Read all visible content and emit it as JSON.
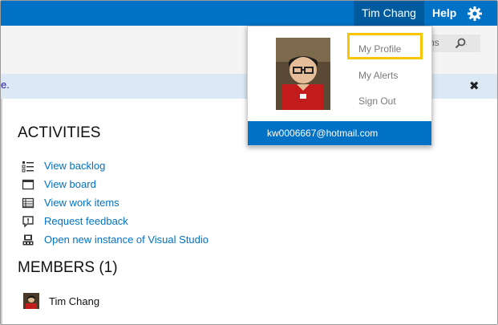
{
  "header": {
    "user_name": "Tim Chang",
    "help_label": "Help"
  },
  "toolbar": {
    "search_partial": "ns"
  },
  "banner": {
    "text_fragment": "e.",
    "close_symbol": "✖"
  },
  "activities": {
    "title": "ACTIVITIES",
    "items": [
      {
        "label": "View backlog",
        "icon": "backlog-list-icon"
      },
      {
        "label": "View board",
        "icon": "board-window-icon"
      },
      {
        "label": "View work items",
        "icon": "work-items-grid-icon"
      },
      {
        "label": "Request feedback",
        "icon": "feedback-speech-icon"
      },
      {
        "label": "Open new instance of Visual Studio",
        "icon": "visual-studio-icon"
      }
    ]
  },
  "members": {
    "title": "MEMBERS (1)",
    "list": [
      {
        "name": "Tim Chang"
      }
    ]
  },
  "profile_menu": {
    "items": [
      "My Profile",
      "My Alerts",
      "Sign Out"
    ],
    "email": "kw0006667@hotmail.com",
    "highlight_color": "#f7c600"
  },
  "colors": {
    "accent": "#0072c6",
    "accent_dark": "#005a9e",
    "banner": "#dde8f5"
  }
}
